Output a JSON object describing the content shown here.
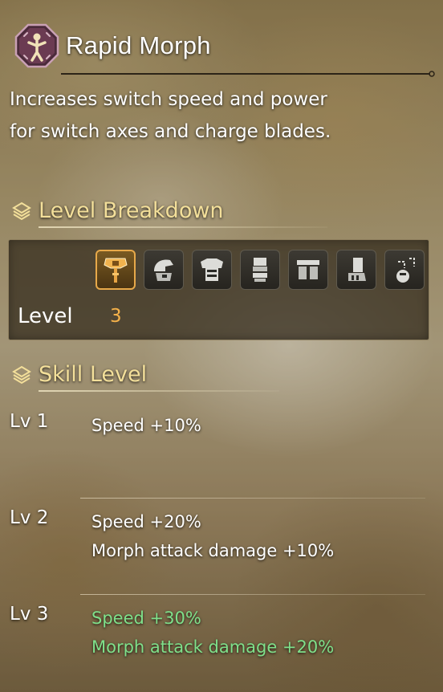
{
  "skill": {
    "name": "Rapid Morph",
    "description_lines": [
      "Increases switch speed and power",
      "for switch axes and charge blades."
    ],
    "icon": "rapid-morph-skill-icon"
  },
  "level_breakdown": {
    "heading": "Level Breakdown",
    "equipment": [
      {
        "slot": "weapon",
        "icon": "switch-axe-weapon-icon",
        "active": true
      },
      {
        "slot": "head",
        "icon": "helmet-icon",
        "active": false
      },
      {
        "slot": "chest",
        "icon": "chest-armor-icon",
        "active": false
      },
      {
        "slot": "arms",
        "icon": "gauntlet-icon",
        "active": false
      },
      {
        "slot": "waist",
        "icon": "waist-armor-icon",
        "active": false
      },
      {
        "slot": "legs",
        "icon": "leg-armor-icon",
        "active": false
      },
      {
        "slot": "talisman",
        "icon": "talisman-icon",
        "active": false
      }
    ],
    "level_label": "Level",
    "level_value": "3"
  },
  "skill_level": {
    "heading": "Skill Level",
    "levels": [
      {
        "name": "Lv 1",
        "effects": [
          "Speed +10%"
        ],
        "current": false
      },
      {
        "name": "Lv 2",
        "effects": [
          "Speed +20%",
          "Morph attack damage +10%"
        ],
        "current": false
      },
      {
        "name": "Lv 3",
        "effects": [
          "Speed +30%",
          "Morph attack damage +20%"
        ],
        "current": true
      }
    ]
  },
  "colors": {
    "heading_gold": "#f3df9a",
    "level_value_orange": "#f6b24a",
    "current_level_green": "#7fe08a",
    "active_slot_border": "#e7a94a"
  }
}
